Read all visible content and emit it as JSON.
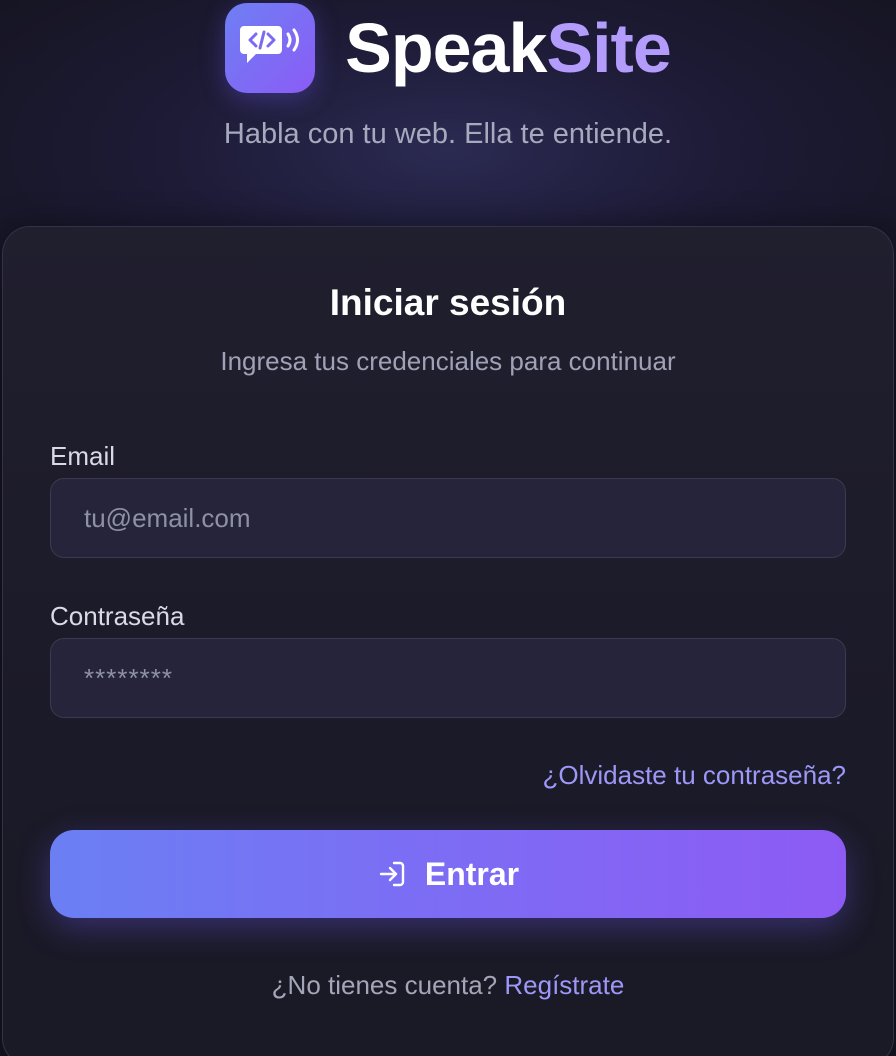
{
  "brand": {
    "name_part1": "Speak",
    "name_part2": "Site",
    "logo_icon": "code-chat-speaker-icon",
    "tagline": "Habla con tu web. Ella te entiende."
  },
  "login": {
    "title": "Iniciar sesión",
    "subtitle": "Ingresa tus credenciales para continuar",
    "email_label": "Email",
    "email_placeholder": "tu@email.com",
    "email_value": "",
    "password_label": "Contraseña",
    "password_placeholder": "********",
    "password_value": "",
    "forgot_link": "¿Olvidaste tu contraseña?",
    "submit_label": "Entrar",
    "submit_icon": "login-arrow-icon",
    "no_account_text": "¿No tienes cuenta?",
    "register_link": "Regístrate"
  },
  "colors": {
    "accent": "#8b5cf6",
    "accent_start": "#6b7ff3",
    "link": "#9d97f8",
    "background": "#15141f",
    "card": "#1e1d2c"
  }
}
